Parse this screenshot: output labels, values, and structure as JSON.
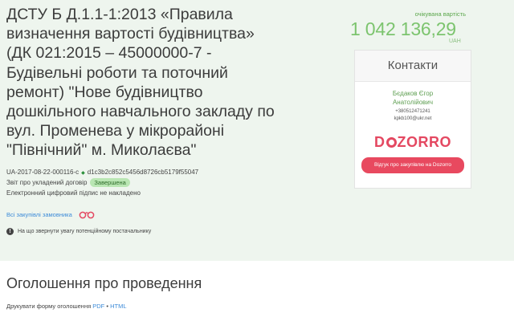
{
  "tender": {
    "title": "ДСТУ Б Д.1.1-1:2013 «Правила визначення вартості будівництва» (ДК 021:2015 – 45000000-7 - Будівельні роботи та поточний ремонт) \"Нове будівництво дошкільного навчального закладу по вул. Променева у мікрорайоні \"Північний\" м. Миколаєва\"",
    "id": "UA-2017-08-22-000116-c",
    "hash": "d1c3b2c852c5456d8726cb5179f55047",
    "separator": "◆",
    "contract_report_label": "Звіт про укладений договір",
    "status": "Завершена",
    "signature_note": "Електронний цифровий підпис не накладено"
  },
  "price": {
    "label": "очікувана вартість",
    "amount": "1 042 136,29",
    "currency": "UAH"
  },
  "contacts": {
    "heading": "Контакти",
    "person_line1": "Бєдаков Єгор",
    "person_line2": "Анатолійович",
    "phone": "+380512471241",
    "email": "kpkb100@ukr.net"
  },
  "dozorro": {
    "logo_left": "D",
    "logo_right": "ZORRO",
    "button": "Відгук про закупівлю на Dozorro"
  },
  "links": {
    "all_purchases": "Всі закупівлі замовника",
    "notice": "На що звернути увагу потенційному постачальнику"
  },
  "announcement": {
    "heading": "Оголошення про проведення",
    "print_label": "Друкувати форму оголошення",
    "pdf": "PDF",
    "dot": "•",
    "html": "HTML"
  },
  "colors": {
    "header_bg": "#eef5ee",
    "price": "#7cc46e",
    "dozorro": "#e44861",
    "link": "#3d8bd8",
    "badge_bg": "#b9e6b3"
  }
}
